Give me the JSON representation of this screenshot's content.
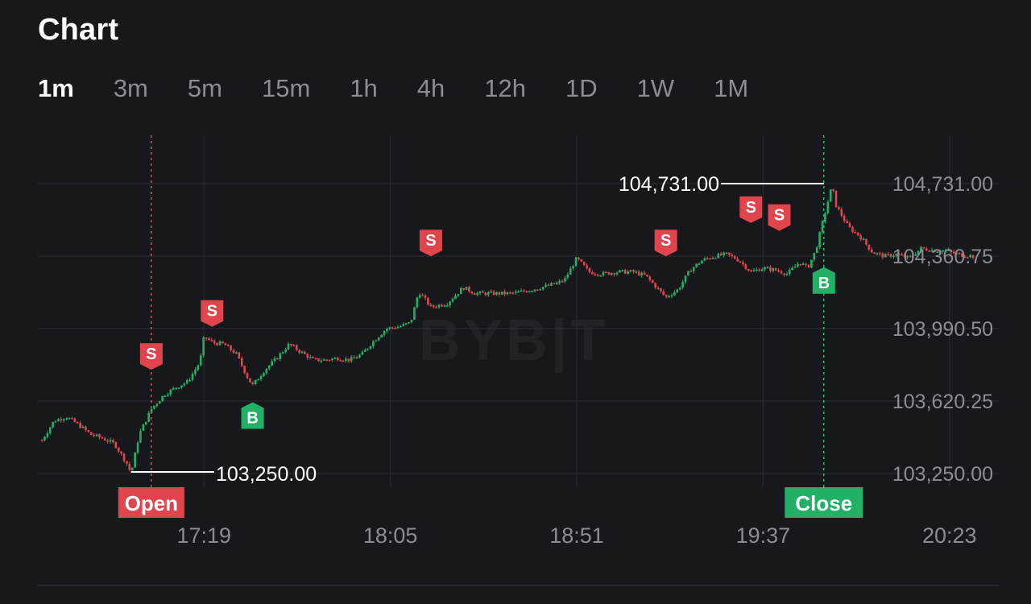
{
  "header": {
    "title": "Chart"
  },
  "timeframes": {
    "items": [
      "1m",
      "3m",
      "5m",
      "15m",
      "1h",
      "4h",
      "12h",
      "1D",
      "1W",
      "1M"
    ],
    "active": "1m"
  },
  "watermark": "BYB|T",
  "colors": {
    "up": "#22b066",
    "down": "#e0454d",
    "background": "#17181c",
    "grid": "#25272c"
  },
  "chart_data": {
    "type": "candlestick",
    "y_ticks": [
      "104,731.00",
      "103,990.50",
      "103,620.25",
      "103,250.00"
    ],
    "y_tick_values": [
      104731.0,
      103990.5,
      103620.25,
      103250.0
    ],
    "ylim": [
      103150,
      104900
    ],
    "x_ticks": [
      "17:19",
      "18:05",
      "18:51",
      "19:37",
      "20:23"
    ],
    "current_price": {
      "label": "104,360.75",
      "value": 104360.75
    },
    "high_marker": {
      "label": "104,731.00",
      "value": 104731.0,
      "time": "19:52"
    },
    "low_marker": {
      "label": "103,250.00",
      "value": 103250.0,
      "time": "17:01"
    },
    "position": {
      "open": {
        "label": "Open",
        "time": "17:06"
      },
      "close": {
        "label": "Close",
        "time": "19:52"
      }
    },
    "trades": [
      {
        "side": "sell",
        "label": "S",
        "time": "17:06",
        "price": 103710
      },
      {
        "side": "sell",
        "label": "S",
        "time": "17:21",
        "price": 103930
      },
      {
        "side": "buy",
        "label": "B",
        "time": "17:31",
        "price": 103680
      },
      {
        "side": "sell",
        "label": "S",
        "time": "18:15",
        "price": 104290
      },
      {
        "side": "sell",
        "label": "S",
        "time": "19:13",
        "price": 104290
      },
      {
        "side": "sell",
        "label": "S",
        "time": "19:34",
        "price": 104460
      },
      {
        "side": "sell",
        "label": "S",
        "time": "19:41",
        "price": 104420
      },
      {
        "side": "buy",
        "label": "B",
        "time": "19:52",
        "price": 104370
      }
    ],
    "price_path": [
      [
        "16:39",
        103420
      ],
      [
        "16:42",
        103520
      ],
      [
        "16:45",
        103540
      ],
      [
        "16:48",
        103500
      ],
      [
        "16:51",
        103450
      ],
      [
        "16:54",
        103430
      ],
      [
        "16:57",
        103400
      ],
      [
        "17:00",
        103300
      ],
      [
        "17:01",
        103250
      ],
      [
        "17:03",
        103450
      ],
      [
        "17:06",
        103580
      ],
      [
        "17:09",
        103650
      ],
      [
        "17:12",
        103690
      ],
      [
        "17:15",
        103720
      ],
      [
        "17:18",
        103820
      ],
      [
        "17:19",
        103950
      ],
      [
        "17:21",
        103920
      ],
      [
        "17:24",
        103910
      ],
      [
        "17:27",
        103860
      ],
      [
        "17:30",
        103730
      ],
      [
        "17:31",
        103700
      ],
      [
        "17:34",
        103780
      ],
      [
        "17:37",
        103840
      ],
      [
        "17:40",
        103910
      ],
      [
        "17:43",
        103870
      ],
      [
        "17:46",
        103830
      ],
      [
        "17:49",
        103830
      ],
      [
        "17:52",
        103840
      ],
      [
        "17:55",
        103830
      ],
      [
        "17:58",
        103860
      ],
      [
        "18:01",
        103930
      ],
      [
        "18:04",
        103990
      ],
      [
        "18:07",
        104000
      ],
      [
        "18:10",
        104020
      ],
      [
        "18:12",
        104180
      ],
      [
        "18:15",
        104100
      ],
      [
        "18:19",
        104120
      ],
      [
        "18:23",
        104200
      ],
      [
        "18:26",
        104170
      ],
      [
        "18:30",
        104170
      ],
      [
        "18:35",
        104170
      ],
      [
        "18:40",
        104190
      ],
      [
        "18:46",
        104220
      ],
      [
        "18:48",
        104240
      ],
      [
        "18:51",
        104350
      ],
      [
        "18:54",
        104280
      ],
      [
        "18:57",
        104270
      ],
      [
        "19:01",
        104280
      ],
      [
        "19:05",
        104280
      ],
      [
        "19:08",
        104260
      ],
      [
        "19:13",
        104150
      ],
      [
        "19:16",
        104190
      ],
      [
        "19:19",
        104290
      ],
      [
        "19:22",
        104340
      ],
      [
        "19:25",
        104360
      ],
      [
        "19:28",
        104370
      ],
      [
        "19:31",
        104340
      ],
      [
        "19:34",
        104280
      ],
      [
        "19:37",
        104300
      ],
      [
        "19:40",
        104290
      ],
      [
        "19:43",
        104270
      ],
      [
        "19:46",
        104330
      ],
      [
        "19:48",
        104300
      ],
      [
        "19:50",
        104390
      ],
      [
        "19:52",
        104560
      ],
      [
        "19:54",
        104720
      ],
      [
        "19:55",
        104620
      ],
      [
        "19:58",
        104510
      ],
      [
        "20:01",
        104460
      ],
      [
        "20:04",
        104380
      ],
      [
        "20:07",
        104360
      ],
      [
        "20:10",
        104370
      ],
      [
        "20:13",
        104350
      ],
      [
        "20:16",
        104400
      ],
      [
        "20:19",
        104390
      ],
      [
        "20:22",
        104390
      ],
      [
        "20:25",
        104370
      ],
      [
        "20:29",
        104360
      ]
    ]
  }
}
